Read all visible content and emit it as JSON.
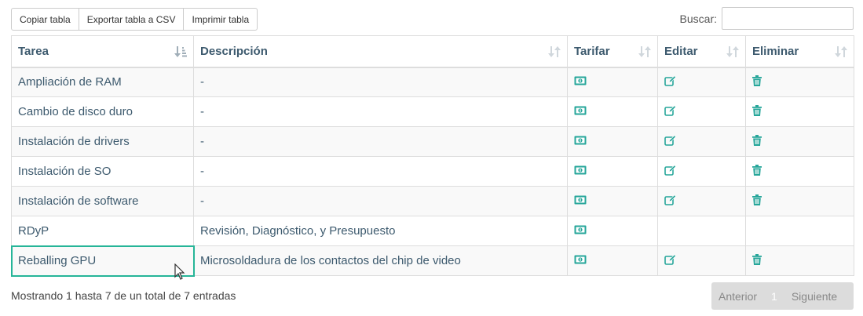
{
  "toolbar": {
    "copy_label": "Copiar tabla",
    "csv_label": "Exportar tabla a CSV",
    "print_label": "Imprimir tabla"
  },
  "search": {
    "label": "Buscar:",
    "value": "",
    "placeholder": ""
  },
  "table": {
    "headers": [
      "Tarea",
      "Descripción",
      "Tarifar",
      "Editar",
      "Eliminar"
    ],
    "sorted_column": "Tarea",
    "rows": [
      {
        "tarea": "Ampliación de RAM",
        "descripcion": "-",
        "tarifar": true,
        "editar": true,
        "eliminar": true
      },
      {
        "tarea": "Cambio de disco duro",
        "descripcion": "-",
        "tarifar": true,
        "editar": true,
        "eliminar": true
      },
      {
        "tarea": "Instalación de drivers",
        "descripcion": "-",
        "tarifar": true,
        "editar": true,
        "eliminar": true
      },
      {
        "tarea": "Instalación de SO",
        "descripcion": "-",
        "tarifar": true,
        "editar": true,
        "eliminar": true
      },
      {
        "tarea": "Instalación de software",
        "descripcion": "-",
        "tarifar": true,
        "editar": true,
        "eliminar": true
      },
      {
        "tarea": "RDyP",
        "descripcion": "Revisión, Diagnóstico, y Presupuesto",
        "tarifar": true,
        "editar": false,
        "eliminar": false
      },
      {
        "tarea": "Reballing GPU",
        "descripcion": "Microsoldadura de los contactos del chip de video",
        "tarifar": true,
        "editar": true,
        "eliminar": true
      }
    ]
  },
  "icons": {
    "tarifar": "money-icon",
    "editar": "edit-icon",
    "eliminar": "trash-icon",
    "sort_active": "sort-amount-down-icon",
    "sort_inactive": "sort-both-icon"
  },
  "colors": {
    "accent": "#26a69a",
    "header_text": "#3d5a6e",
    "selected_border": "#26b598"
  },
  "footer": {
    "info": "Mostrando 1 hasta 7 de un total de 7 entradas",
    "prev_label": "Anterior",
    "page": "1",
    "next_label": "Siguiente"
  }
}
